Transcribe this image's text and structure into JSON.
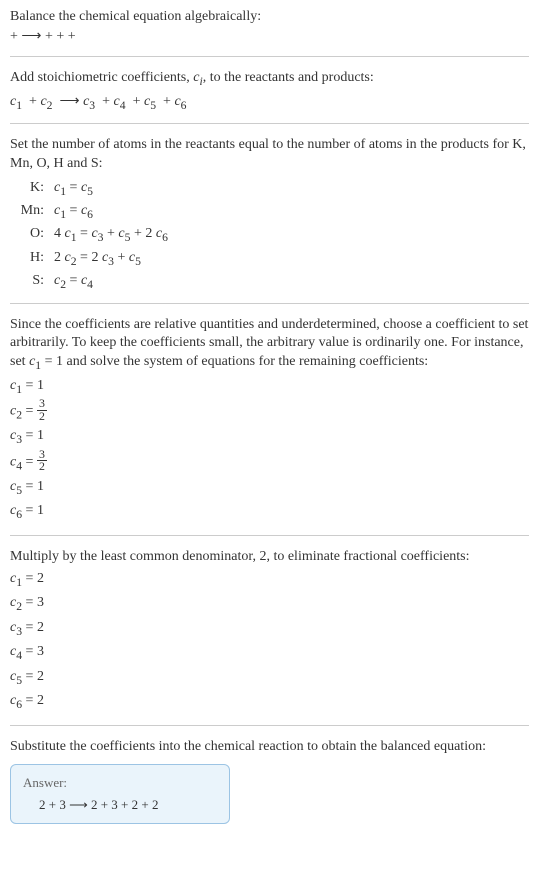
{
  "intro": {
    "line1": "Balance the chemical equation algebraically:",
    "line2": " +  ⟶  +  +  + "
  },
  "step1": {
    "text": "Add stoichiometric coefficients, c_i, to the reactants and products:",
    "equation": "c₁  + c₂  ⟶ c₃  + c₄  + c₅  + c₆"
  },
  "step2": {
    "text": "Set the number of atoms in the reactants equal to the number of atoms in the products for K, Mn, O, H and S:",
    "atoms": [
      {
        "label": "K:",
        "eq": "c₁ = c₅"
      },
      {
        "label": "Mn:",
        "eq": "c₁ = c₆"
      },
      {
        "label": "O:",
        "eq": "4 c₁ = c₃ + c₅ + 2 c₆"
      },
      {
        "label": "H:",
        "eq": "2 c₂ = 2 c₃ + c₅"
      },
      {
        "label": "S:",
        "eq": "c₂ = c₄"
      }
    ]
  },
  "step3": {
    "text": "Since the coefficients are relative quantities and underdetermined, choose a coefficient to set arbitrarily. To keep the coefficients small, the arbitrary value is ordinarily one. For instance, set c₁ = 1 and solve the system of equations for the remaining coefficients:",
    "coefs": [
      {
        "var": "c₁",
        "val": "1",
        "frac": false
      },
      {
        "var": "c₂",
        "num": "3",
        "den": "2",
        "frac": true
      },
      {
        "var": "c₃",
        "val": "1",
        "frac": false
      },
      {
        "var": "c₄",
        "num": "3",
        "den": "2",
        "frac": true
      },
      {
        "var": "c₅",
        "val": "1",
        "frac": false
      },
      {
        "var": "c₆",
        "val": "1",
        "frac": false
      }
    ]
  },
  "step4": {
    "text": "Multiply by the least common denominator, 2, to eliminate fractional coefficients:",
    "coefs": [
      {
        "var": "c₁",
        "val": "2"
      },
      {
        "var": "c₂",
        "val": "3"
      },
      {
        "var": "c₃",
        "val": "2"
      },
      {
        "var": "c₄",
        "val": "3"
      },
      {
        "var": "c₅",
        "val": "2"
      },
      {
        "var": "c₆",
        "val": "2"
      }
    ]
  },
  "step5": {
    "text": "Substitute the coefficients into the chemical reaction to obtain the balanced equation:"
  },
  "answer": {
    "label": "Answer:",
    "equation": "2  + 3  ⟶ 2  + 3  + 2  + 2"
  }
}
